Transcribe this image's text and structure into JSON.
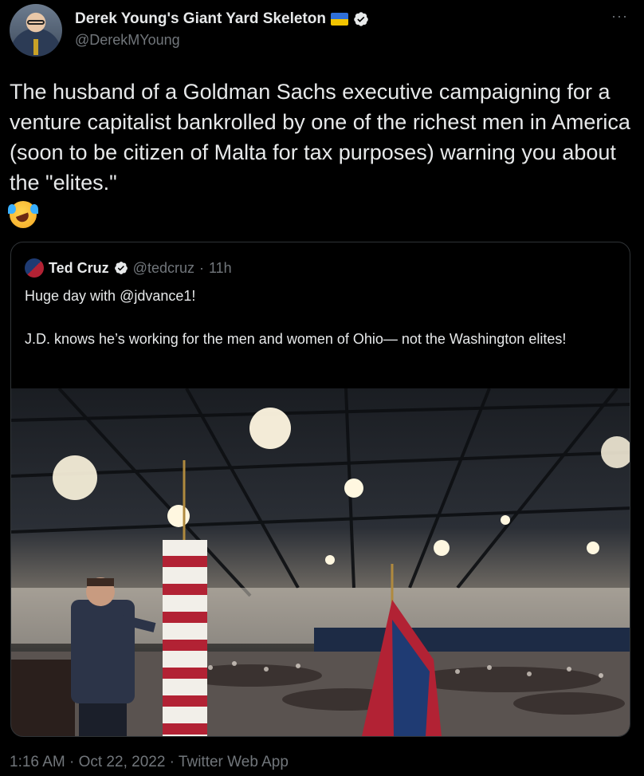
{
  "author": {
    "display_name": "Derek Young's Giant Yard Skeleton",
    "handle": "@DerekMYoung",
    "avatar_icon": "profile-photo",
    "flag": "ukraine-flag",
    "verified": true
  },
  "more_label": "···",
  "tweet": {
    "text": "The husband of a Goldman Sachs executive campaigning for a venture capitalist bankrolled by one of the richest men in America (soon to be citizen of Malta for tax purposes) warning you about the \"elites.\"",
    "emoji": "rolling-on-floor-laughing-emoji"
  },
  "quote": {
    "name": "Ted Cruz",
    "handle": "@tedcruz",
    "separator": "·",
    "time": "11h",
    "verified": true,
    "paragraphs": [
      "Huge day with @jdvance1!",
      "J.D. knows he’s working for the men and women of Ohio— not the Washington elites!"
    ],
    "image": "event-hall-photo"
  },
  "footer": {
    "text": "1:16 AM · Oct 22, 2022 · Twitter Web App"
  },
  "colors": {
    "background": "#000000",
    "text_primary": "#e7e9ea",
    "text_secondary": "#71767b",
    "border": "#2f3336"
  }
}
